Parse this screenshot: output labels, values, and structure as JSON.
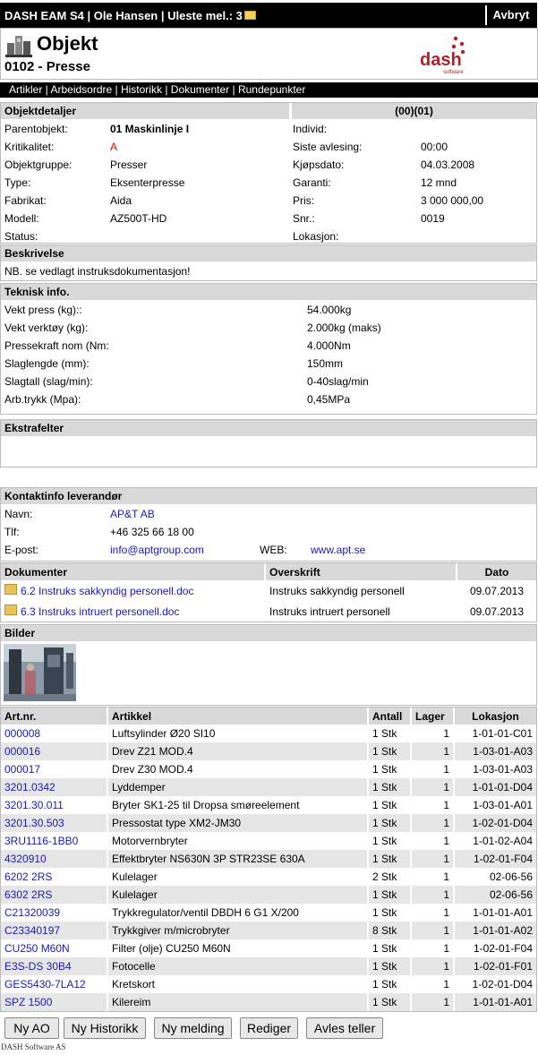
{
  "topbar": {
    "title": "DASH EAM S4 | Ole Hansen | Uleste mel.: 3",
    "cancel": "Avbryt"
  },
  "header": {
    "title": "Objekt",
    "subtitle": "0102 - Presse",
    "logo_text": "dash",
    "logo_sub": "software"
  },
  "nav": [
    "Artikler",
    "Arbeidsordre",
    "Historikk",
    "Dokumenter",
    "Rundepunkter"
  ],
  "details": {
    "heading": "Objektdetaljer",
    "code": "(00)(01)",
    "left": [
      {
        "label": "Parentobjekt:",
        "value": "01 Maskinlinje I"
      },
      {
        "label": "Kritikalitet:",
        "value": "A"
      },
      {
        "label": "Objektgruppe:",
        "value": "Presser"
      },
      {
        "label": "Type:",
        "value": "Eksenterpresse"
      },
      {
        "label": "Fabrikat:",
        "value": "Aida"
      },
      {
        "label": "Modell:",
        "value": "AZ500T-HD"
      },
      {
        "label": "Status:",
        "value": ""
      }
    ],
    "right": [
      {
        "label": "Individ:",
        "value": ""
      },
      {
        "label": "Siste avlesing:",
        "value": "00:00"
      },
      {
        "label": "Kjøpsdato:",
        "value": "04.03.2008"
      },
      {
        "label": "Garanti:",
        "value": "12 mnd"
      },
      {
        "label": "Pris:",
        "value": "3 000 000,00"
      },
      {
        "label": "Snr.:",
        "value": "0019"
      },
      {
        "label": "Lokasjon:",
        "value": ""
      }
    ]
  },
  "description": {
    "heading": "Beskrivelse",
    "text": "NB. se vedlagt instruksdokumentasjon!"
  },
  "tech": {
    "heading": "Teknisk info.",
    "rows": [
      {
        "label": "Vekt press (kg)::",
        "value": "54.000kg"
      },
      {
        "label": "Vekt verktøy (kg):",
        "value": "2.000kg (maks)"
      },
      {
        "label": "Pressekraft nom (Nm:",
        "value": "4.000Nm"
      },
      {
        "label": "Slaglengde (mm):",
        "value": "150mm"
      },
      {
        "label": "Slagtall (slag/min):",
        "value": "0-40slag/min"
      },
      {
        "label": "Arb.trykk (Mpa):",
        "value": "0,45MPa"
      }
    ]
  },
  "extra": {
    "heading": "Ekstrafelter"
  },
  "contact": {
    "heading": "Kontaktinfo leverandør",
    "name_label": "Navn:",
    "name": "AP&T AB",
    "phone_label": "Tlf:",
    "phone": "+46 325 66 18 00",
    "email_label": "E-post:",
    "email": "info@aptgroup.com",
    "web_label": "WEB:",
    "web": "www.apt.se"
  },
  "documents": {
    "headers": [
      "Dokumenter",
      "Overskrift",
      "Dato"
    ],
    "rows": [
      {
        "name": "6.2 Instruks sakkyndig personell.doc",
        "title": "Instruks sakkyndig personell",
        "date": "09.07.2013"
      },
      {
        "name": "6.3 Instruks intruert personell.doc",
        "title": "Instruks intruert personell",
        "date": "09.07.2013"
      }
    ]
  },
  "images": {
    "heading": "Bilder"
  },
  "articles": {
    "headers": [
      "Art.nr.",
      "Artikkel",
      "Antall",
      "Lager",
      "Lokasjon"
    ],
    "rows": [
      {
        "nr": "000008",
        "name": "Luftsylinder Ø20 SI10",
        "qty": "1 Stk",
        "stock": "1",
        "loc": "1-01-01-C01"
      },
      {
        "nr": "000016",
        "name": "Drev Z21 MOD.4",
        "qty": "1 Stk",
        "stock": "1",
        "loc": "1-03-01-A03"
      },
      {
        "nr": "000017",
        "name": "Drev Z30 MOD.4",
        "qty": "1 Stk",
        "stock": "1",
        "loc": "1-03-01-A03"
      },
      {
        "nr": "3201.0342",
        "name": "Lyddemper",
        "qty": "1 Stk",
        "stock": "1",
        "loc": "1-01-01-D04"
      },
      {
        "nr": "3201.30.011",
        "name": "Bryter SK1-25 til Dropsa smøreelement",
        "qty": "1 Stk",
        "stock": "1",
        "loc": "1-03-01-A01"
      },
      {
        "nr": "3201.30.503",
        "name": "Pressostat type XM2-JM30",
        "qty": "1 Stk",
        "stock": "1",
        "loc": "1-02-01-D04"
      },
      {
        "nr": "3RU1116-1BB0",
        "name": "Motorvernbryter",
        "qty": "1 Stk",
        "stock": "1",
        "loc": "1-01-02-A04"
      },
      {
        "nr": "4320910",
        "name": "Effektbryter NS630N 3P STR23SE 630A",
        "qty": "1 Stk",
        "stock": "1",
        "loc": "1-02-01-F04"
      },
      {
        "nr": "6202 2RS",
        "name": "Kulelager",
        "qty": "2 Stk",
        "stock": "1",
        "loc": "02-06-56"
      },
      {
        "nr": "6302 2RS",
        "name": "Kulelager",
        "qty": "1 Stk",
        "stock": "1",
        "loc": "02-06-56"
      },
      {
        "nr": "C21320039",
        "name": "Trykkregulator/ventil DBDH 6 G1 X/200",
        "qty": "1 Stk",
        "stock": "1",
        "loc": "1-01-01-A01"
      },
      {
        "nr": "C23340197",
        "name": "Trykkgiver m/microbryter",
        "qty": "8 Stk",
        "stock": "1",
        "loc": "1-01-01-A02"
      },
      {
        "nr": "CU250 M60N",
        "name": "Filter (olje) CU250 M60N",
        "qty": "1 Stk",
        "stock": "1",
        "loc": "1-02-01-F04"
      },
      {
        "nr": "E3S-DS 30B4",
        "name": "Fotocelle",
        "qty": "1 Stk",
        "stock": "1",
        "loc": "1-02-01-F01"
      },
      {
        "nr": "GES5430-7LA12",
        "name": "Kretskort",
        "qty": "1 Stk",
        "stock": "1",
        "loc": "1-02-01-D04"
      },
      {
        "nr": "SPZ 1500",
        "name": "Kilereim",
        "qty": "1 Stk",
        "stock": "1",
        "loc": "1-01-01-A01"
      }
    ]
  },
  "buttons": [
    "Ny AO",
    "Ny Historikk",
    "Ny melding",
    "Rediger",
    "Avles teller"
  ],
  "footer": "DASH Software AS",
  "colors": {
    "link": "#1a1ab0",
    "critical": "#e00000",
    "header_bg": "#d9d9d9",
    "alt_row": "#e6e6e6",
    "brand": "#b0202a"
  }
}
